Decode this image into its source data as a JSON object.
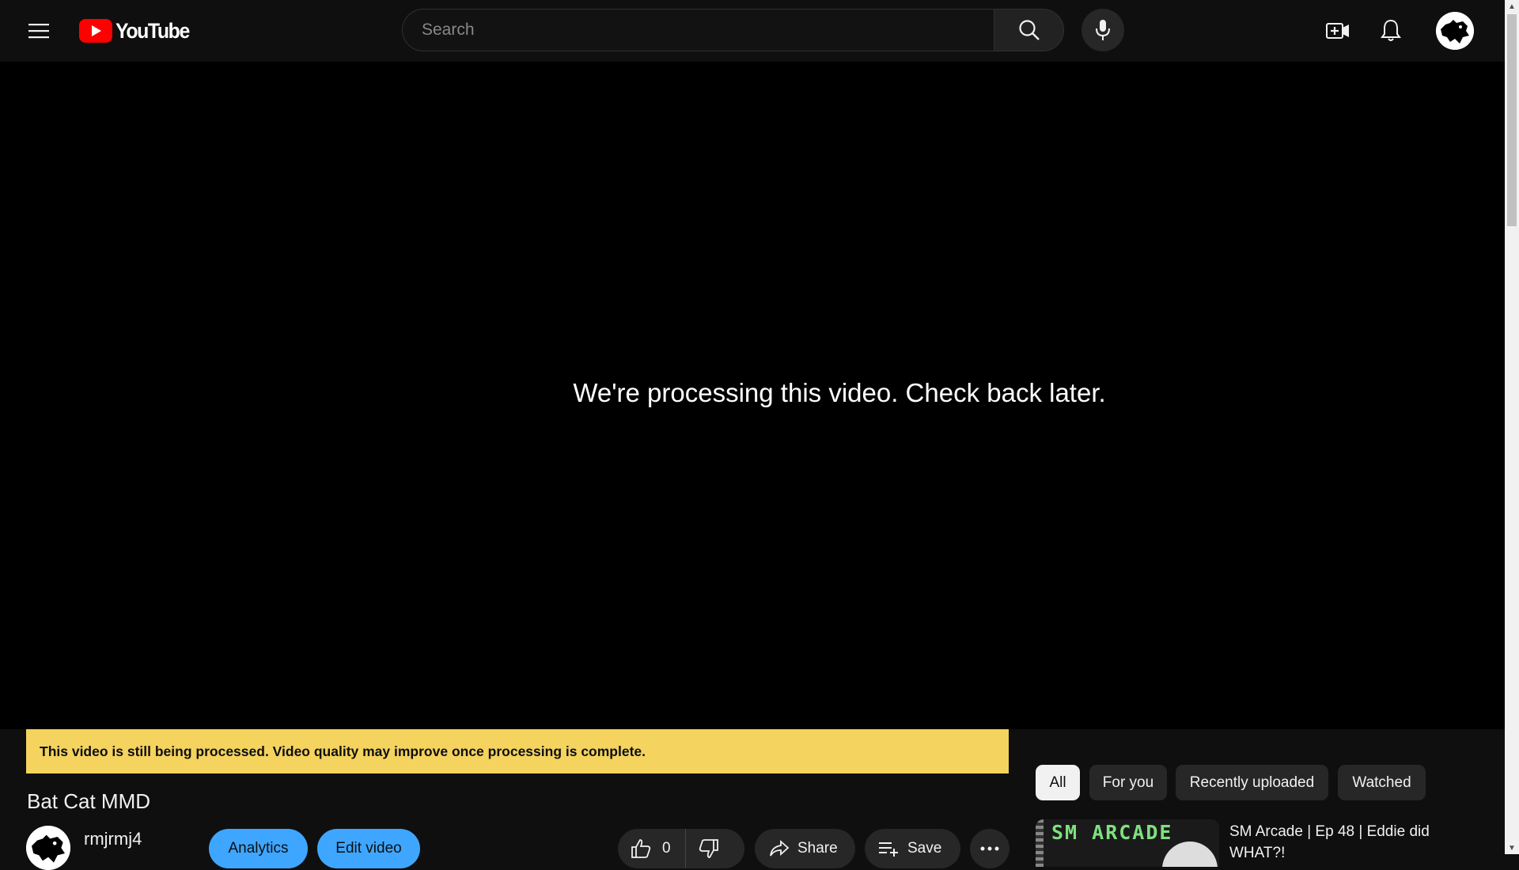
{
  "masthead": {
    "logo_text": "YouTube",
    "search_placeholder": "Search"
  },
  "player": {
    "message": "We're processing this video. Check back later."
  },
  "banner": {
    "text": "This video is still being processed. Video quality may improve once processing is complete."
  },
  "video": {
    "title": "Bat Cat MMD",
    "channel_name": "rmjrmj4",
    "analytics_label": "Analytics",
    "edit_label": "Edit video",
    "like_count": "0",
    "share_label": "Share",
    "save_label": "Save"
  },
  "chips": [
    {
      "label": "All",
      "active": true
    },
    {
      "label": "For you",
      "active": false
    },
    {
      "label": "Recently uploaded",
      "active": false
    },
    {
      "label": "Watched",
      "active": false
    }
  ],
  "recommendations": [
    {
      "thumb_text": "SM ARCADE",
      "title": "SM Arcade | Ep 48 | Eddie did WHAT?!"
    }
  ],
  "colors": {
    "background": "#0f0f0f",
    "banner": "#f4d35e",
    "accent_blue": "#3ea6ff",
    "logo_red": "#ff0000"
  }
}
